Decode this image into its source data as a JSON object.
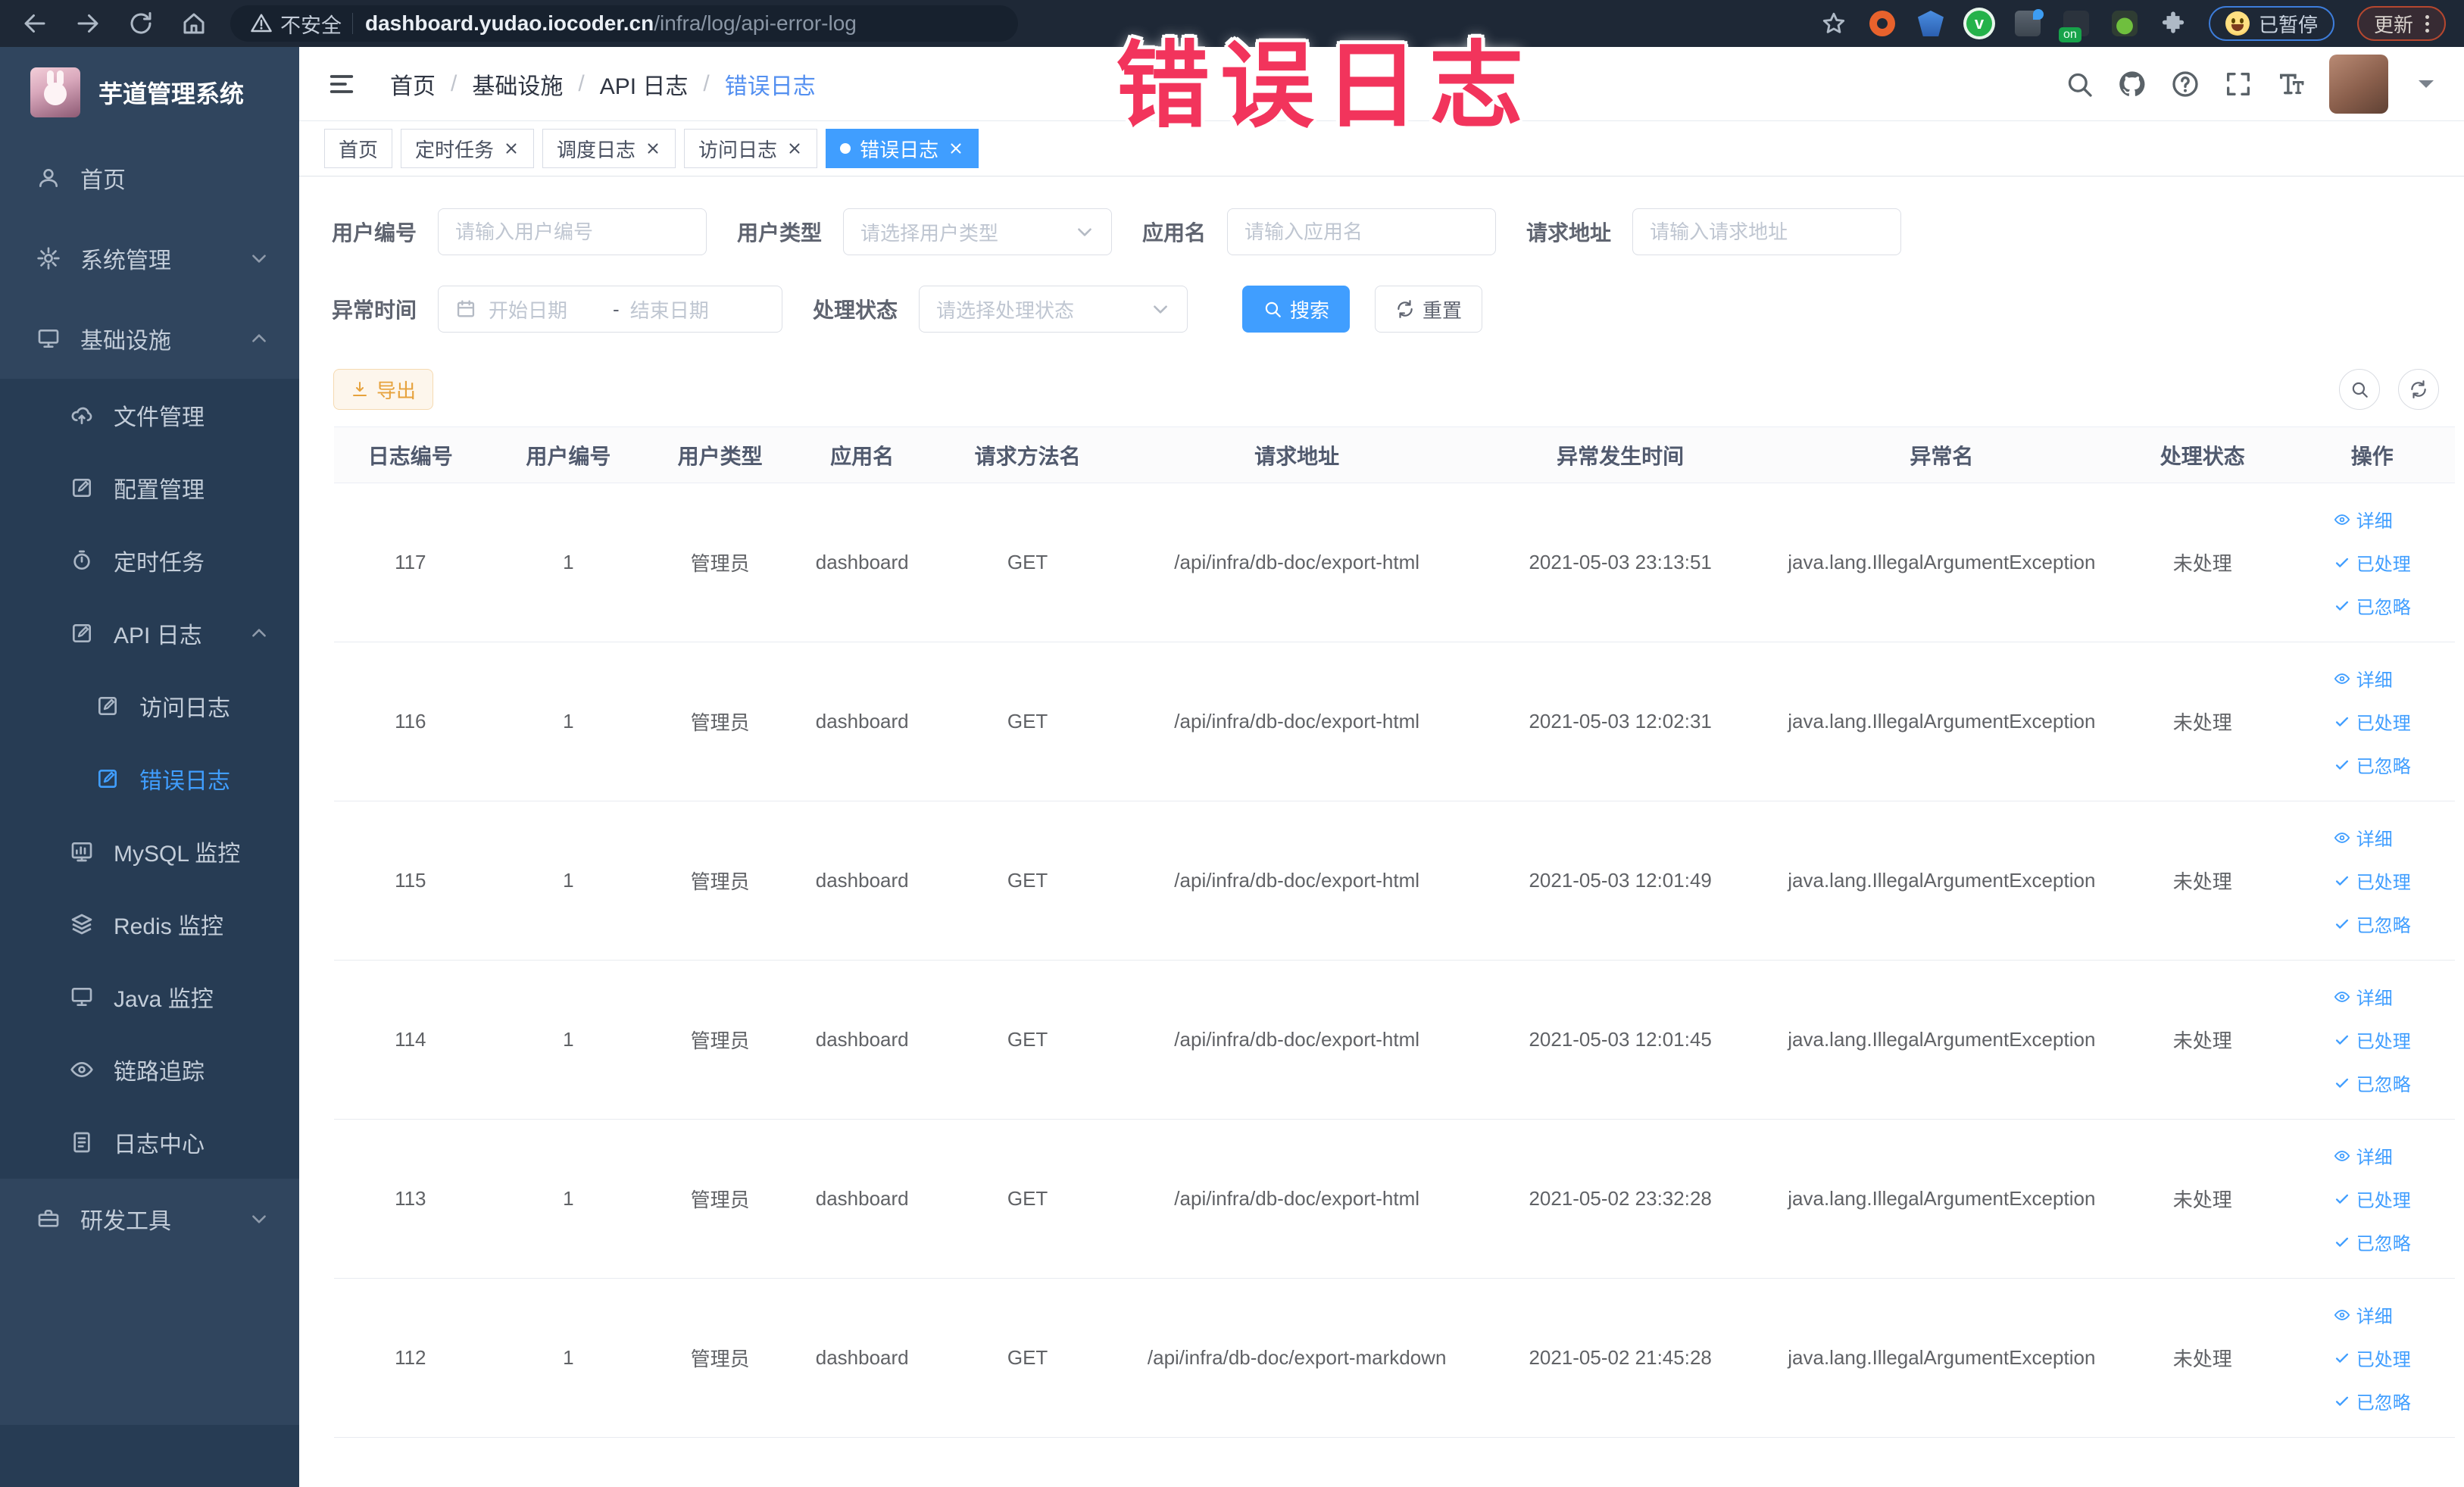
{
  "browser": {
    "nav_icons": [
      "back-arrow",
      "forward-arrow",
      "reload",
      "home"
    ],
    "security_label": "不安全",
    "url_host": "dashboard.yudao.iocoder.cn",
    "url_path": "/infra/log/api-error-log",
    "extension_icons": [
      "bookmark-star",
      "orange-ring-extension",
      "blue-shield-extension",
      "green-check-extension",
      "grid-extension",
      "on-badge-extension",
      "sprout-extension",
      "puzzle-extension"
    ],
    "paused_chip": "已暂停",
    "update_chip": "更新"
  },
  "annotation": {
    "text": "错误日志",
    "color": "#f2345c"
  },
  "sidebar": {
    "app_title": "芋道管理系统",
    "items": [
      {
        "label": "首页",
        "icon": "home"
      },
      {
        "label": "系统管理",
        "icon": "gear",
        "chevron": "down"
      },
      {
        "label": "基础设施",
        "icon": "monitor",
        "chevron": "up"
      },
      {
        "label": "文件管理",
        "icon": "cloud-upload"
      },
      {
        "label": "配置管理",
        "icon": "edit-square"
      },
      {
        "label": "定时任务",
        "icon": "timer"
      },
      {
        "label": "API 日志",
        "icon": "edit-square",
        "chevron": "up"
      },
      {
        "label": "访问日志",
        "icon": "edit-square"
      },
      {
        "label": "错误日志",
        "icon": "edit-square",
        "active": true
      },
      {
        "label": "MySQL 监控",
        "icon": "chart"
      },
      {
        "label": "Redis 监控",
        "icon": "layers"
      },
      {
        "label": "Java 监控",
        "icon": "display"
      },
      {
        "label": "链路追踪",
        "icon": "eye"
      },
      {
        "label": "日志中心",
        "icon": "document"
      },
      {
        "label": "研发工具",
        "icon": "briefcase",
        "chevron": "down"
      }
    ]
  },
  "header": {
    "breadcrumb": [
      "首页",
      "基础设施",
      "API 日志",
      "错误日志"
    ],
    "separator": "/",
    "right_icons": [
      "search",
      "github",
      "help",
      "fullscreen",
      "font-size"
    ]
  },
  "tabs": [
    {
      "label": "首页"
    },
    {
      "label": "定时任务"
    },
    {
      "label": "调度日志"
    },
    {
      "label": "访问日志"
    },
    {
      "label": "错误日志",
      "active": true
    }
  ],
  "filters": {
    "user_id": {
      "label": "用户编号",
      "placeholder": "请输入用户编号"
    },
    "user_type": {
      "label": "用户类型",
      "placeholder": "请选择用户类型"
    },
    "app_name": {
      "label": "应用名",
      "placeholder": "请输入应用名"
    },
    "request_url": {
      "label": "请求地址",
      "placeholder": "请输入请求地址"
    },
    "exception_time": {
      "label": "异常时间",
      "start_placeholder": "开始日期",
      "separator": "-",
      "end_placeholder": "结束日期"
    },
    "process_status": {
      "label": "处理状态",
      "placeholder": "请选择处理状态"
    },
    "search_button": "搜索",
    "reset_button": "重置"
  },
  "toolbar": {
    "export_button": "导出"
  },
  "table": {
    "columns": [
      "日志编号",
      "用户编号",
      "用户类型",
      "应用名",
      "请求方法名",
      "请求地址",
      "异常发生时间",
      "异常名",
      "处理状态",
      "操作"
    ],
    "row_actions": [
      {
        "icon": "eye",
        "label": "详细"
      },
      {
        "icon": "check",
        "label": "已处理"
      },
      {
        "icon": "check",
        "label": "已忽略"
      }
    ],
    "rows": [
      {
        "id": "117",
        "user_id": "1",
        "user_type": "管理员",
        "app_name": "dashboard",
        "method": "GET",
        "url": "/api/infra/db-doc/export-html",
        "time": "2021-05-03 23:13:51",
        "exception": "java.lang.IllegalArgumentException",
        "status": "未处理"
      },
      {
        "id": "116",
        "user_id": "1",
        "user_type": "管理员",
        "app_name": "dashboard",
        "method": "GET",
        "url": "/api/infra/db-doc/export-html",
        "time": "2021-05-03 12:02:31",
        "exception": "java.lang.IllegalArgumentException",
        "status": "未处理"
      },
      {
        "id": "115",
        "user_id": "1",
        "user_type": "管理员",
        "app_name": "dashboard",
        "method": "GET",
        "url": "/api/infra/db-doc/export-html",
        "time": "2021-05-03 12:01:49",
        "exception": "java.lang.IllegalArgumentException",
        "status": "未处理"
      },
      {
        "id": "114",
        "user_id": "1",
        "user_type": "管理员",
        "app_name": "dashboard",
        "method": "GET",
        "url": "/api/infra/db-doc/export-html",
        "time": "2021-05-03 12:01:45",
        "exception": "java.lang.IllegalArgumentException",
        "status": "未处理"
      },
      {
        "id": "113",
        "user_id": "1",
        "user_type": "管理员",
        "app_name": "dashboard",
        "method": "GET",
        "url": "/api/infra/db-doc/export-html",
        "time": "2021-05-02 23:32:28",
        "exception": "java.lang.IllegalArgumentException",
        "status": "未处理"
      },
      {
        "id": "112",
        "user_id": "1",
        "user_type": "管理员",
        "app_name": "dashboard",
        "method": "GET",
        "url": "/api/infra/db-doc/export-markdown",
        "time": "2021-05-02 21:45:28",
        "exception": "java.lang.IllegalArgumentException",
        "status": "未处理"
      }
    ]
  }
}
